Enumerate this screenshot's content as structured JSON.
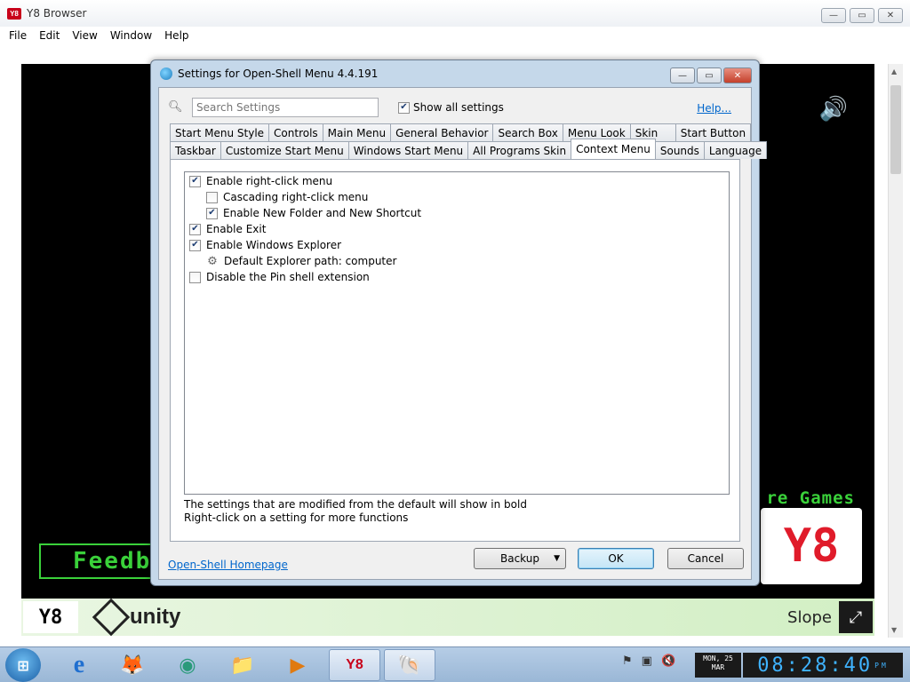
{
  "browser": {
    "title": "Y8 Browser",
    "logo": "Y8",
    "controls": {
      "minimize": "—",
      "maximize": "▭",
      "close": "✕"
    },
    "menu": [
      "File",
      "Edit",
      "View",
      "Window",
      "Help"
    ]
  },
  "game": {
    "sound_icon": "🔊",
    "more_games": "re Games",
    "logo_text": "Y8",
    "feedback": "Feedb",
    "name": "Slope",
    "unity_label": "unity",
    "y8_badge": "Y8",
    "fullscreen_icon": "⤢"
  },
  "dialog": {
    "title": "Settings for Open-Shell Menu 4.4.191",
    "search_placeholder": "Search Settings",
    "show_all_label": "Show all settings",
    "show_all_checked": "✔",
    "help_label": "Help...",
    "tabs_row1": [
      "Start Menu Style",
      "Controls",
      "Main Menu",
      "General Behavior",
      "Search Box",
      "Menu Look",
      "Skin",
      "Start Button"
    ],
    "tabs_row2": [
      "Taskbar",
      "Customize Start Menu",
      "Windows Start Menu",
      "All Programs Skin",
      "Context Menu",
      "Sounds",
      "Language"
    ],
    "active_tab": "Context Menu",
    "settings": [
      {
        "label": "Enable right-click menu",
        "checked": "✔"
      },
      {
        "label": "Cascading right-click menu",
        "checked": ""
      },
      {
        "label": "Enable New Folder and New Shortcut",
        "checked": "✔"
      },
      {
        "label": "Enable Exit",
        "checked": "✔"
      },
      {
        "label": "Enable Windows Explorer",
        "checked": "✔"
      },
      {
        "label": "Default Explorer path: computer",
        "checked": ""
      },
      {
        "label": "Disable the Pin shell extension",
        "checked": ""
      }
    ],
    "note1": "The settings that are modified from the default will show in bold",
    "note2": "Right-click on a setting for more functions",
    "homepage_link": "Open-Shell Homepage",
    "backup_label": "Backup",
    "ok_label": "OK",
    "cancel_label": "Cancel"
  },
  "taskbar": {
    "tray_icons": [
      "⚑",
      "▣",
      "🔇"
    ],
    "date_line1": "MON, 25",
    "date_line2": "MAR",
    "time": "08:28:40",
    "ampm": "PM",
    "apps": [
      "e",
      "🦊",
      "◉",
      "📁",
      "▶",
      "Y8",
      "🐚"
    ]
  }
}
